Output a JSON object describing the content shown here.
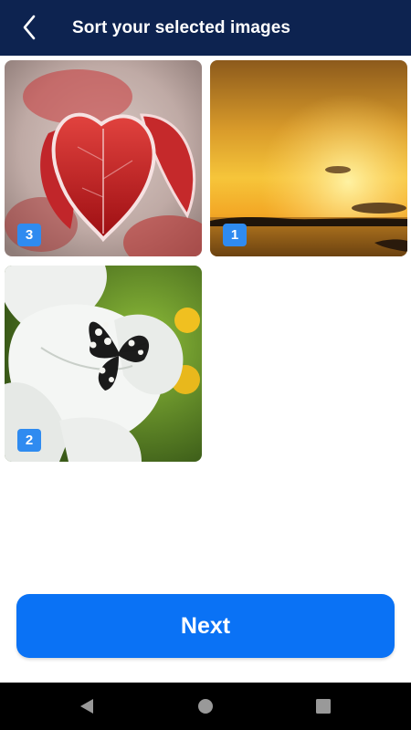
{
  "header": {
    "title": "Sort your selected images",
    "background": "#0d2350"
  },
  "images": [
    {
      "name": "red-frosted-leaf",
      "badge": "3"
    },
    {
      "name": "sunset-lake",
      "badge": "1"
    },
    {
      "name": "butterfly-on-petunia",
      "badge": "2"
    }
  ],
  "next_button": {
    "label": "Next",
    "color": "#0a72f5"
  },
  "nav_bar": {
    "buttons": [
      "back-triangle-icon",
      "home-circle-icon",
      "recents-square-icon"
    ]
  }
}
